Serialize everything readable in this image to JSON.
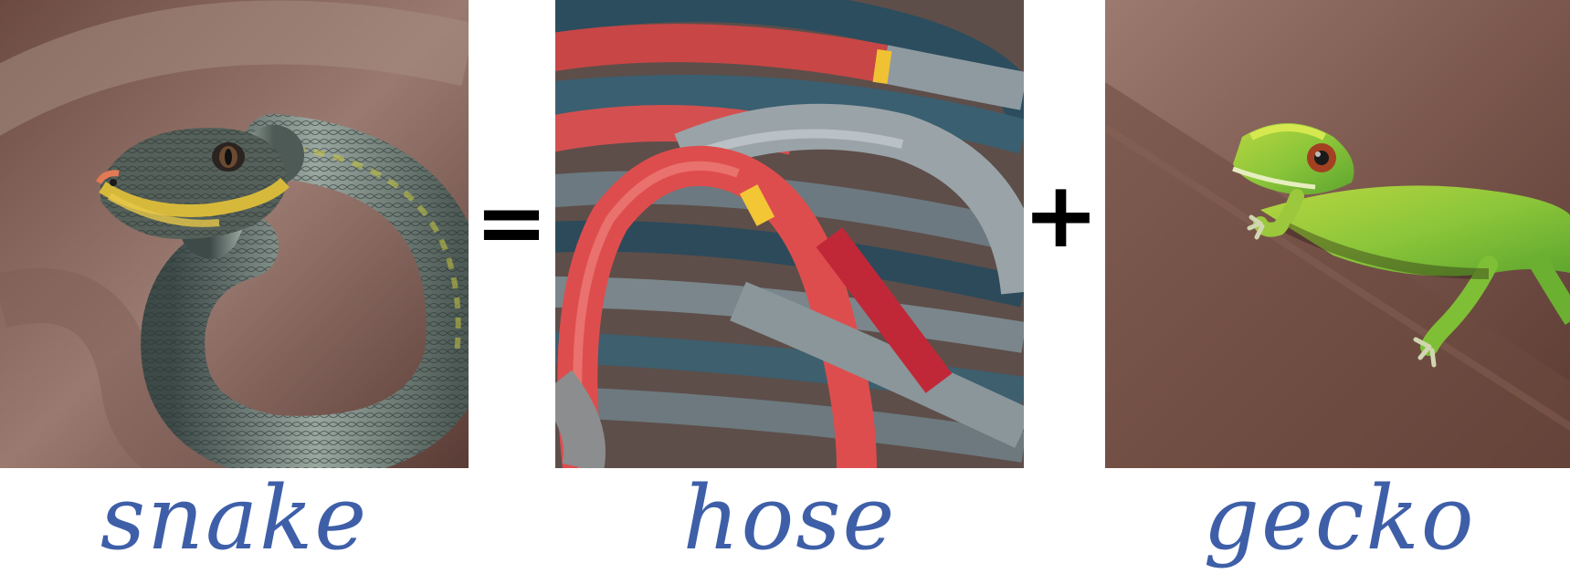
{
  "equation": {
    "operator_equals": "=",
    "operator_plus": "+"
  },
  "panels": [
    {
      "label": "snake",
      "icon": "snake-photo"
    },
    {
      "label": "hose",
      "icon": "hose-photo"
    },
    {
      "label": "gecko",
      "icon": "gecko-photo"
    }
  ],
  "colors": {
    "label_text": "#3e5fa8",
    "operator_text": "#000000",
    "background": "#ffffff"
  }
}
